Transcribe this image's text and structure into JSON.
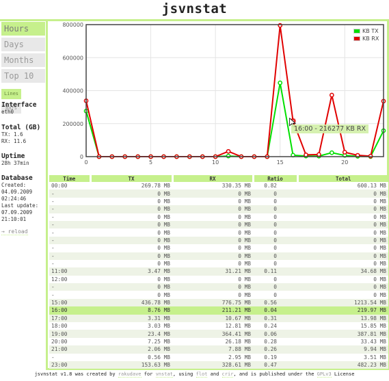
{
  "app": {
    "title": "jsvnstat"
  },
  "nav": {
    "items": [
      {
        "label": "Hours",
        "active": true
      },
      {
        "label": "Days",
        "active": false
      },
      {
        "label": "Months",
        "active": false
      },
      {
        "label": "Top 10",
        "active": false
      }
    ],
    "chart_types": [
      {
        "label": "Lines",
        "active": true
      },
      {
        "label": "Bars",
        "active": false
      }
    ]
  },
  "sidebar": {
    "interface_heading": "Interface",
    "interface_value": "eth0",
    "total_heading": "Total (GB)",
    "total_tx": "TX: 1.6",
    "total_rx": "RX: 11.6",
    "uptime_heading": "Uptime",
    "uptime_value": "28h 37min",
    "database_heading": "Database",
    "created_label": "Created:",
    "created_date": "04.09.2009",
    "created_time": "02:24:46",
    "updated_label": "Last update:",
    "updated_date": "07.09.2009",
    "updated_time": "21:10:01",
    "reload_label": "→ reload"
  },
  "colors": {
    "accent": "#c6f08c",
    "tx": "#00e000",
    "rx": "#e00000"
  },
  "tooltip": {
    "text": "16:00 - 216277 KB RX"
  },
  "chart_data": {
    "type": "line",
    "title": "",
    "xlabel": "",
    "ylabel": "",
    "x": [
      0,
      1,
      2,
      3,
      4,
      5,
      6,
      7,
      8,
      9,
      10,
      11,
      12,
      13,
      14,
      15,
      16,
      17,
      18,
      19,
      20,
      21,
      22,
      23
    ],
    "xticks": [
      0,
      5,
      10,
      15,
      20
    ],
    "yticks": [
      0,
      200000,
      400000,
      600000,
      800000
    ],
    "xlim": [
      0,
      23
    ],
    "ylim": [
      0,
      800000
    ],
    "grid": true,
    "legend_position": "top-right",
    "series": [
      {
        "name": "KB TX",
        "color": "#00e000",
        "values": [
          276250,
          0,
          0,
          0,
          0,
          0,
          0,
          0,
          0,
          0,
          0,
          3553,
          0,
          0,
          0,
          447263,
          8970,
          3389,
          3103,
          23962,
          7424,
          2109,
          573,
          157317
        ]
      },
      {
        "name": "KB RX",
        "color": "#e00000",
        "values": [
          338278,
          0,
          0,
          0,
          0,
          0,
          0,
          0,
          0,
          0,
          0,
          31959,
          0,
          0,
          0,
          795392,
          216277,
          10926,
          13117,
          373156,
          26808,
          8069,
          3021,
          336497
        ]
      }
    ]
  },
  "table": {
    "headers": [
      "Time",
      "TX",
      "RX",
      "Ratio",
      "Total"
    ],
    "rows": [
      {
        "time": "00:00",
        "tx": "269.78 MB",
        "rx": "330.35 MB",
        "ratio": "0.82",
        "total": "600.13 MB"
      },
      {
        "time": "-",
        "tx": "0 MB",
        "rx": "0 MB",
        "ratio": "0",
        "total": "0 MB"
      },
      {
        "time": "-",
        "tx": "0 MB",
        "rx": "0 MB",
        "ratio": "0",
        "total": "0 MB"
      },
      {
        "time": "-",
        "tx": "0 MB",
        "rx": "0 MB",
        "ratio": "0",
        "total": "0 MB"
      },
      {
        "time": "-",
        "tx": "0 MB",
        "rx": "0 MB",
        "ratio": "0",
        "total": "0 MB"
      },
      {
        "time": "-",
        "tx": "0 MB",
        "rx": "0 MB",
        "ratio": "0",
        "total": "0 MB"
      },
      {
        "time": "-",
        "tx": "0 MB",
        "rx": "0 MB",
        "ratio": "0",
        "total": "0 MB"
      },
      {
        "time": "-",
        "tx": "0 MB",
        "rx": "0 MB",
        "ratio": "0",
        "total": "0 MB"
      },
      {
        "time": "-",
        "tx": "0 MB",
        "rx": "0 MB",
        "ratio": "0",
        "total": "0 MB"
      },
      {
        "time": "-",
        "tx": "0 MB",
        "rx": "0 MB",
        "ratio": "0",
        "total": "0 MB"
      },
      {
        "time": "-",
        "tx": "0 MB",
        "rx": "0 MB",
        "ratio": "0",
        "total": "0 MB"
      },
      {
        "time": "11:00",
        "tx": "3.47 MB",
        "rx": "31.21 MB",
        "ratio": "0.11",
        "total": "34.68 MB"
      },
      {
        "time": "12:00",
        "tx": "0 MB",
        "rx": "0 MB",
        "ratio": "0",
        "total": "0 MB"
      },
      {
        "time": "-",
        "tx": "0 MB",
        "rx": "0 MB",
        "ratio": "0",
        "total": "0 MB"
      },
      {
        "time": "-",
        "tx": "0 MB",
        "rx": "0 MB",
        "ratio": "0",
        "total": "0 MB"
      },
      {
        "time": "15:00",
        "tx": "436.78 MB",
        "rx": "776.75 MB",
        "ratio": "0.56",
        "total": "1213.54 MB"
      },
      {
        "time": "16:00",
        "tx": "8.76 MB",
        "rx": "211.21 MB",
        "ratio": "0.04",
        "total": "219.97 MB",
        "highlight": true
      },
      {
        "time": "17:00",
        "tx": "3.31 MB",
        "rx": "10.67 MB",
        "ratio": "0.31",
        "total": "13.98 MB"
      },
      {
        "time": "18:00",
        "tx": "3.03 MB",
        "rx": "12.81 MB",
        "ratio": "0.24",
        "total": "15.85 MB"
      },
      {
        "time": "19:00",
        "tx": "23.4 MB",
        "rx": "364.41 MB",
        "ratio": "0.06",
        "total": "387.81 MB"
      },
      {
        "time": "20:00",
        "tx": "7.25 MB",
        "rx": "26.18 MB",
        "ratio": "0.28",
        "total": "33.43 MB"
      },
      {
        "time": "21:00",
        "tx": "2.06 MB",
        "rx": "7.88 MB",
        "ratio": "0.26",
        "total": "9.94 MB"
      },
      {
        "time": "-",
        "tx": "0.56 MB",
        "rx": "2.95 MB",
        "ratio": "0.19",
        "total": "3.51 MB"
      },
      {
        "time": "23:00",
        "tx": "153.63 MB",
        "rx": "328.61 MB",
        "ratio": "0.47",
        "total": "482.23 MB"
      }
    ]
  },
  "footer": {
    "part1": "jsvnstat v1.8 was created by ",
    "link1": "rakudave",
    "part2": " for ",
    "link2": "vnstat",
    "part3": ", using ",
    "link3": "flot",
    "part4": " and ",
    "link4": "crir",
    "part5": ", and is published under the ",
    "link5": "GPLv3",
    "part6": " License"
  }
}
